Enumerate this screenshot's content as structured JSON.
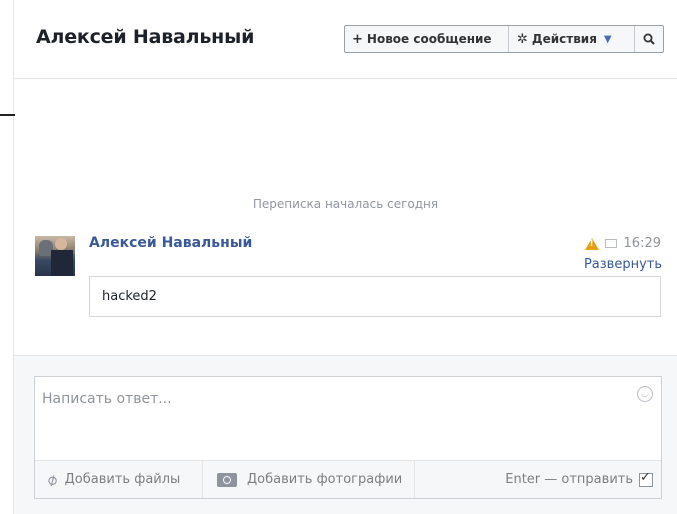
{
  "header": {
    "title": "Алексей Навальный",
    "new_message_label": "Новое сообщение",
    "actions_label": "Действия"
  },
  "conversation": {
    "started_label": "Переписка началась сегодня",
    "message": {
      "sender": "Алексей Навальный",
      "time": "16:29",
      "expand_label": "Развернуть",
      "text": "hacked2"
    }
  },
  "composer": {
    "placeholder": "Написать ответ...",
    "add_files_label": "Добавить файлы",
    "add_photos_label": "Добавить фотографии",
    "enter_send_label": "Enter — отправить"
  },
  "icons": {
    "new_message": "plus-icon",
    "actions": "gear-icon",
    "search": "search-icon",
    "warning": "warning-icon",
    "mail": "envelope-icon",
    "emoji": "smiley-icon",
    "attach": "paperclip-icon",
    "photo": "camera-icon",
    "checkbox": "checkbox-icon"
  },
  "colors": {
    "link_blue": "#3b5998",
    "warning": "#e4a012",
    "muted_text": "#90949c"
  }
}
